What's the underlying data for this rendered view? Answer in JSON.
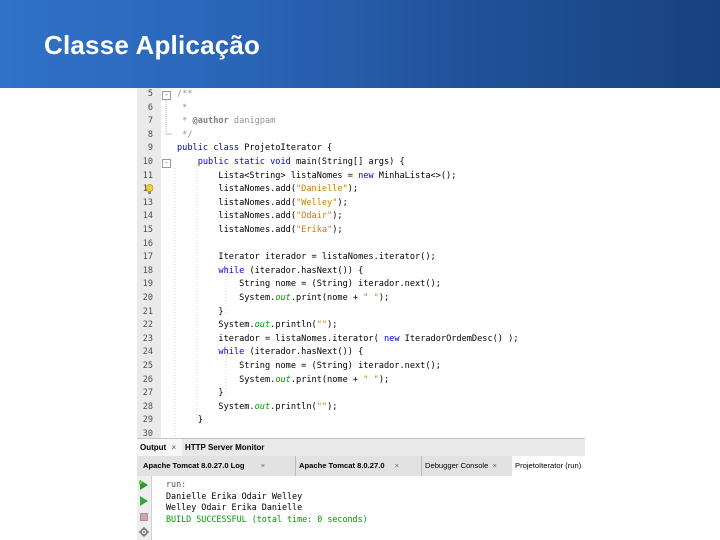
{
  "slide": {
    "title": "Classe Aplicação"
  },
  "editor": {
    "lines": [
      {
        "num": "5",
        "fold": "-",
        "segments": [
          {
            "t": "/**",
            "c": "cm"
          }
        ]
      },
      {
        "num": "6",
        "fold": "",
        "segments": [
          {
            "t": " *",
            "c": "cm"
          }
        ]
      },
      {
        "num": "7",
        "fold": "",
        "segments": [
          {
            "t": " * ",
            "c": "cm"
          },
          {
            "t": "@author",
            "c": "tag"
          },
          {
            "t": " danigpam",
            "c": "cm"
          }
        ]
      },
      {
        "num": "8",
        "fold": "",
        "segments": [
          {
            "t": " */",
            "c": "cm"
          }
        ]
      },
      {
        "num": "9",
        "fold": "",
        "segments": [
          {
            "t": "public class",
            "c": "kw"
          },
          {
            "t": " ProjetoIterator {",
            "c": ""
          }
        ]
      },
      {
        "num": "10",
        "fold": "-",
        "segments": [
          {
            "t": "    public static void",
            "c": "kw"
          },
          {
            "t": " main(String[] args) {",
            "c": ""
          }
        ]
      },
      {
        "num": "11",
        "fold": "",
        "segments": [
          {
            "t": "        Lista<String> listaNomes = ",
            "c": ""
          },
          {
            "t": "new",
            "c": "kw"
          },
          {
            "t": " MinhaLista<>();",
            "c": ""
          }
        ]
      },
      {
        "num": "12",
        "fold": "",
        "bulb": true,
        "segments": [
          {
            "t": "        listaNomes.add(",
            "c": ""
          },
          {
            "t": "\"Danielle\"",
            "c": "str"
          },
          {
            "t": ");",
            "c": ""
          }
        ]
      },
      {
        "num": "13",
        "fold": "",
        "segments": [
          {
            "t": "        listaNomes.add(",
            "c": ""
          },
          {
            "t": "\"Welley\"",
            "c": "str"
          },
          {
            "t": ");",
            "c": ""
          }
        ]
      },
      {
        "num": "14",
        "fold": "",
        "segments": [
          {
            "t": "        listaNomes.add(",
            "c": ""
          },
          {
            "t": "\"Odair\"",
            "c": "str"
          },
          {
            "t": ");",
            "c": ""
          }
        ]
      },
      {
        "num": "15",
        "fold": "",
        "segments": [
          {
            "t": "        listaNomes.add(",
            "c": ""
          },
          {
            "t": "\"Erika\"",
            "c": "str"
          },
          {
            "t": ");",
            "c": ""
          }
        ]
      },
      {
        "num": "16",
        "fold": "",
        "segments": []
      },
      {
        "num": "17",
        "fold": "",
        "segments": [
          {
            "t": "        Iterator iterador = listaNomes.iterator();",
            "c": ""
          }
        ]
      },
      {
        "num": "18",
        "fold": "",
        "segments": [
          {
            "t": "        while",
            "c": "kw"
          },
          {
            "t": " (iterador.hasNext()) {",
            "c": ""
          }
        ]
      },
      {
        "num": "19",
        "fold": "",
        "segments": [
          {
            "t": "            String nome = (String) iterador.next();",
            "c": ""
          }
        ]
      },
      {
        "num": "20",
        "fold": "",
        "segments": [
          {
            "t": "            System.",
            "c": ""
          },
          {
            "t": "out",
            "c": "sf"
          },
          {
            "t": ".print(nome + ",
            "c": ""
          },
          {
            "t": "\" \"",
            "c": "str"
          },
          {
            "t": ");",
            "c": ""
          }
        ]
      },
      {
        "num": "21",
        "fold": "",
        "segments": [
          {
            "t": "        }",
            "c": ""
          }
        ]
      },
      {
        "num": "22",
        "fold": "",
        "segments": [
          {
            "t": "        System.",
            "c": ""
          },
          {
            "t": "out",
            "c": "sf"
          },
          {
            "t": ".println(",
            "c": ""
          },
          {
            "t": "\"\"",
            "c": "str"
          },
          {
            "t": ");",
            "c": ""
          }
        ]
      },
      {
        "num": "23",
        "fold": "",
        "segments": [
          {
            "t": "        iterador = listaNomes.iterator( ",
            "c": ""
          },
          {
            "t": "new",
            "c": "kw"
          },
          {
            "t": " IteradorOrdemDesc() );",
            "c": ""
          }
        ]
      },
      {
        "num": "24",
        "fold": "",
        "segments": [
          {
            "t": "        while",
            "c": "kw"
          },
          {
            "t": " (iterador.hasNext()) {",
            "c": ""
          }
        ]
      },
      {
        "num": "25",
        "fold": "",
        "segments": [
          {
            "t": "            String nome = (String) iterador.next();",
            "c": ""
          }
        ]
      },
      {
        "num": "26",
        "fold": "",
        "segments": [
          {
            "t": "            System.",
            "c": ""
          },
          {
            "t": "out",
            "c": "sf"
          },
          {
            "t": ".print(nome + ",
            "c": ""
          },
          {
            "t": "\" \"",
            "c": "str"
          },
          {
            "t": ");",
            "c": ""
          }
        ]
      },
      {
        "num": "27",
        "fold": "",
        "segments": [
          {
            "t": "        }",
            "c": ""
          }
        ]
      },
      {
        "num": "28",
        "fold": "",
        "segments": [
          {
            "t": "        System.",
            "c": ""
          },
          {
            "t": "out",
            "c": "sf"
          },
          {
            "t": ".println(",
            "c": ""
          },
          {
            "t": "\"\"",
            "c": "str"
          },
          {
            "t": ");",
            "c": ""
          }
        ]
      },
      {
        "num": "29",
        "fold": "",
        "segments": [
          {
            "t": "    }",
            "c": ""
          }
        ]
      },
      {
        "num": "30",
        "fold": "",
        "segments": []
      }
    ]
  },
  "output_panel": {
    "tabs": [
      {
        "label": "Output",
        "close": "×"
      },
      {
        "label": "HTTP Server Monitor",
        "close": ""
      }
    ],
    "sub_tabs": [
      {
        "label": "Apache Tomcat 8.0.27.0 Log",
        "close": "×"
      },
      {
        "label": "Apache Tomcat 8.0.27.0",
        "close": "×"
      },
      {
        "label": "Debugger Console",
        "close": "×"
      },
      {
        "label": "ProjetoIterator (run)",
        "close": ""
      }
    ],
    "lines": [
      {
        "text": "run:",
        "style": "run"
      },
      {
        "text": "Danielle Erika Odair Welley",
        "style": ""
      },
      {
        "text": "Welley Odair Erika Danielle",
        "style": ""
      },
      {
        "text": "BUILD SUCCESSFUL (total time: 0 seconds)",
        "style": "green"
      }
    ],
    "side_icons": [
      "run-again-icon",
      "run-icon",
      "stop-icon",
      "settings-icon"
    ]
  },
  "colors": {
    "header_start": "#2f72c9",
    "header_end": "#17427f",
    "keyword": "#0000e6",
    "string": "#ce7b00",
    "comment": "#969696",
    "success": "#009900"
  }
}
